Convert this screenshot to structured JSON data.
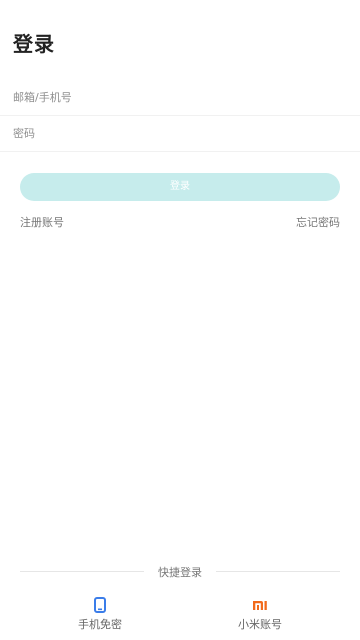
{
  "header": {
    "title": "登录"
  },
  "form": {
    "email_placeholder": "邮箱/手机号",
    "password_placeholder": "密码",
    "login_label": "登录"
  },
  "links": {
    "register": "注册账号",
    "forgot_password": "忘记密码"
  },
  "quick_login": {
    "divider_label": "快捷登录",
    "options": [
      {
        "label": "手机免密",
        "icon": "phone-icon",
        "color": "#3b7de9"
      },
      {
        "label": "小米账号",
        "icon": "mi-logo-icon",
        "color": "#f26a1b"
      }
    ]
  },
  "colors": {
    "login_button_bg": "#c6ecec"
  }
}
